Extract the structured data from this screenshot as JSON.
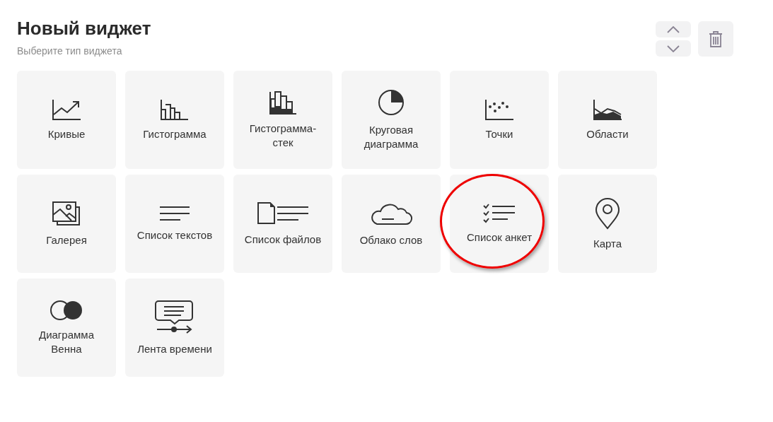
{
  "header": {
    "title": "Новый виджет",
    "subtitle": "Выберите тип виджета"
  },
  "controls": [
    {
      "kind": "up"
    },
    {
      "kind": "down"
    },
    {
      "kind": "delete"
    }
  ],
  "widgets": [
    {
      "kind": "lines",
      "label": "Кривые",
      "highlighted": false
    },
    {
      "kind": "histogram",
      "label": "Гистограмма",
      "highlighted": false
    },
    {
      "kind": "stacked",
      "label": "Гистограмма-стек",
      "highlighted": false
    },
    {
      "kind": "pie",
      "label": "Круговая диаграмма",
      "highlighted": false
    },
    {
      "kind": "scatter",
      "label": "Точки",
      "highlighted": false
    },
    {
      "kind": "area",
      "label": "Области",
      "highlighted": false
    },
    {
      "kind": "gallery",
      "label": "Галерея",
      "highlighted": false
    },
    {
      "kind": "textlist",
      "label": "Список текстов",
      "highlighted": false
    },
    {
      "kind": "filelist",
      "label": "Список файлов",
      "highlighted": false
    },
    {
      "kind": "cloud",
      "label": "Облако слов",
      "highlighted": false
    },
    {
      "kind": "checklist",
      "label": "Список анкет",
      "highlighted": true
    },
    {
      "kind": "map",
      "label": "Карта",
      "highlighted": false
    },
    {
      "kind": "venn",
      "label": "Диаграмма Венна",
      "highlighted": false
    },
    {
      "kind": "timeline",
      "label": "Лента времени",
      "highlighted": false
    }
  ]
}
